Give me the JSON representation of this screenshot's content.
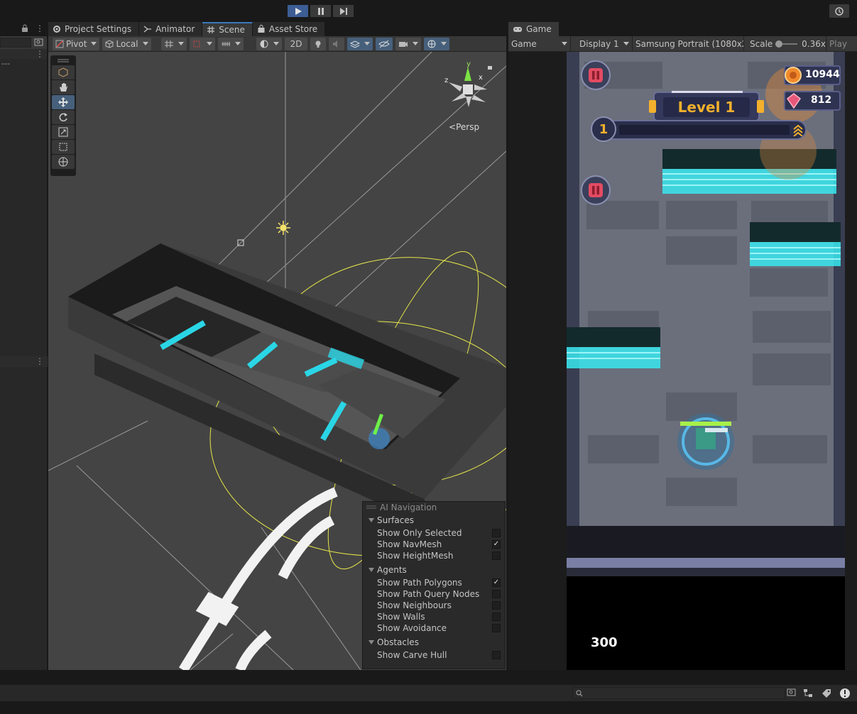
{
  "toolbar": {
    "play_icon": "play-icon",
    "pause_icon": "pause-icon",
    "step_icon": "step-icon",
    "history_icon": "history-icon"
  },
  "hierarchy": {
    "dashes": "---"
  },
  "tabs": [
    {
      "label": "Project Settings",
      "icon": "gear-icon"
    },
    {
      "label": "Animator",
      "icon": "animator-icon"
    },
    {
      "label": "Scene",
      "icon": "grid-icon"
    },
    {
      "label": "Asset Store",
      "icon": "bag-icon"
    }
  ],
  "scene_toolbar": {
    "pivot": "Pivot",
    "local": "Local",
    "mode_2d": "2D",
    "persp": "Persp"
  },
  "ai_nav": {
    "title": "AI Navigation",
    "surfaces": {
      "header": "Surfaces",
      "items": [
        {
          "label": "Show Only Selected",
          "checked": false
        },
        {
          "label": "Show NavMesh",
          "checked": true
        },
        {
          "label": "Show HeightMesh",
          "checked": false
        }
      ]
    },
    "agents": {
      "header": "Agents",
      "items": [
        {
          "label": "Show Path Polygons",
          "checked": true
        },
        {
          "label": "Show Path Query Nodes",
          "checked": false
        },
        {
          "label": "Show Neighbours",
          "checked": false
        },
        {
          "label": "Show Walls",
          "checked": false
        },
        {
          "label": "Show Avoidance",
          "checked": false
        }
      ]
    },
    "obstacles": {
      "header": "Obstacles",
      "items": [
        {
          "label": "Show Carve Hull",
          "checked": false
        }
      ]
    }
  },
  "game_tab": {
    "label": "Game",
    "icon": "gamepad-icon",
    "mode": "Game",
    "display": "Display 1",
    "resolution": "Samsung Portrait (1080x2",
    "scale_label": "Scale",
    "scale_value": "0.36x",
    "play_label": "Play"
  },
  "game_hud": {
    "coins": "10944",
    "gems": "812",
    "level": "Level 1",
    "rank": "1",
    "score": "300"
  },
  "colors": {
    "accent": "#3d5d95",
    "neon": "#38e8f0",
    "gizmo_yellow": "#e6e64a",
    "level_gold": "#f3b02c"
  }
}
